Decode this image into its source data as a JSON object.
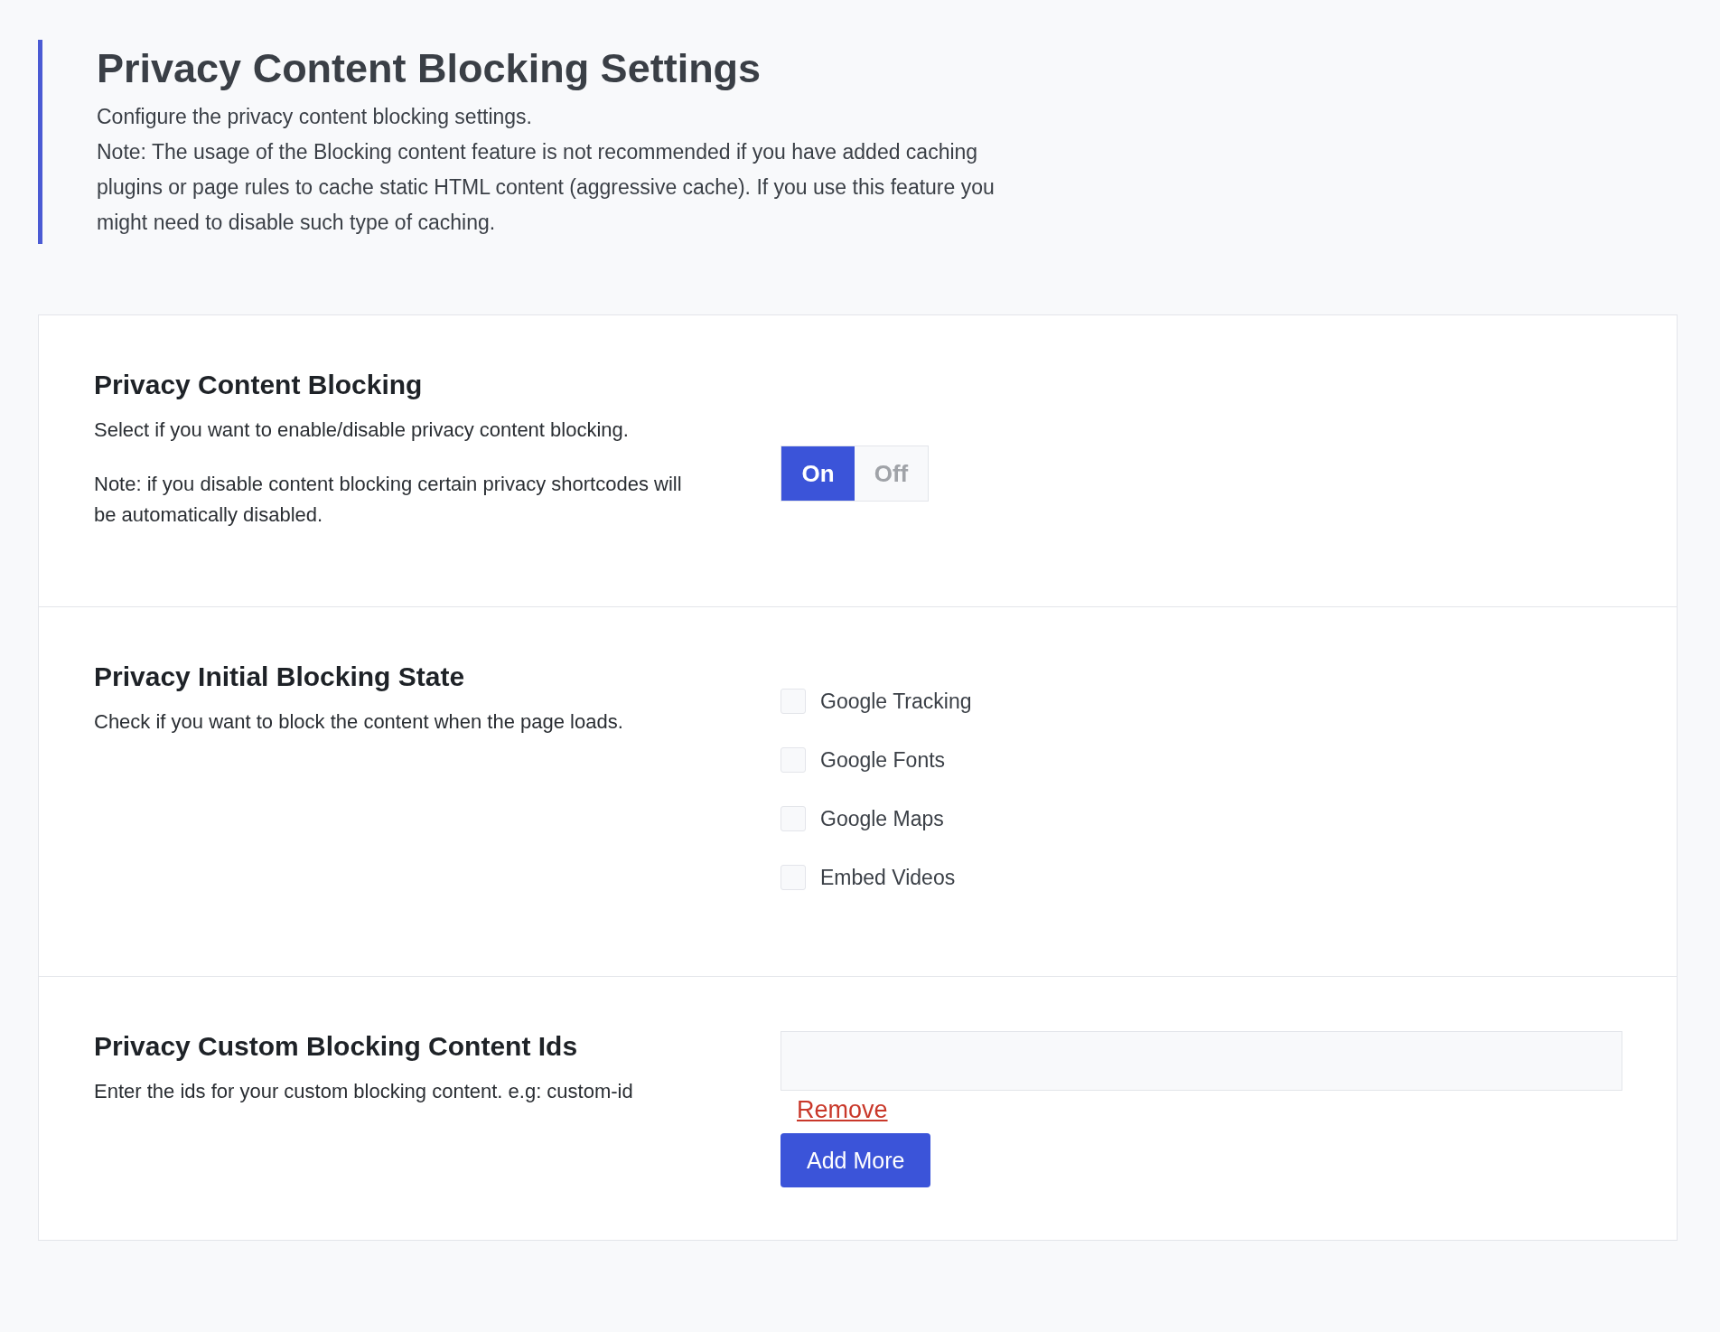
{
  "header": {
    "title": "Privacy Content Blocking Settings",
    "lines": [
      "Configure the privacy content blocking settings.",
      "Note: The usage of the Blocking content feature is not recommended if you have added caching plugins or page rules to cache static HTML content (aggressive cache). If you use this feature you might need to disable such type of caching."
    ]
  },
  "sections": [
    {
      "kind": "toggle",
      "title": "Privacy Content Blocking",
      "paragraphs": [
        "Select if you want to enable/disable privacy content blocking.",
        "Note: if you disable content blocking certain privacy shortcodes will be automatically disabled."
      ],
      "options": [
        {
          "label": "On",
          "selected": true
        },
        {
          "label": "Off",
          "selected": false
        }
      ]
    },
    {
      "kind": "checkboxes",
      "title": "Privacy Initial Blocking State",
      "paragraphs": [
        "Check if you want to block the content when the page loads."
      ],
      "items": [
        {
          "label": "Google Tracking",
          "checked": false
        },
        {
          "label": "Google Fonts",
          "checked": false
        },
        {
          "label": "Google Maps",
          "checked": false
        },
        {
          "label": "Embed Videos",
          "checked": false
        }
      ]
    },
    {
      "kind": "ids",
      "title": "Privacy Custom Blocking Content Ids",
      "paragraphs": [
        "Enter the ids for your custom blocking content. e.g: custom-id"
      ],
      "remove_link": "Remove",
      "add_button": "Add More"
    }
  ]
}
